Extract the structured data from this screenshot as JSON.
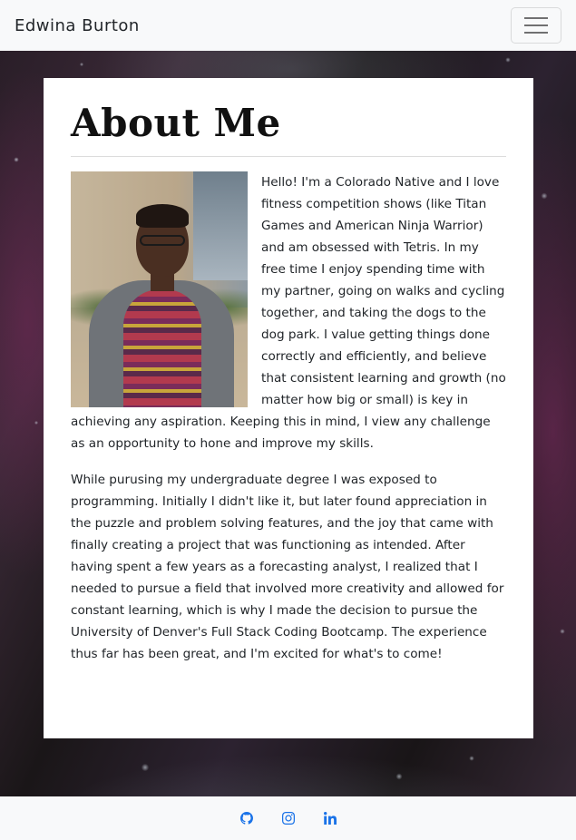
{
  "navbar": {
    "brand": "Edwina Burton",
    "toggler_icon": "hamburger-menu-icon"
  },
  "about": {
    "title": "About Me",
    "photo_icon": "profile-photo",
    "paragraphs": [
      "Hello! I'm a Colorado Native and I love fitness competition shows (like Titan Games and American Ninja Warrior) and am obsessed with Tetris. In my free time I enjoy spending time with my partner, going on walks and cycling together, and taking the dogs to the dog park. I value getting things done correctly and efficiently, and believe that consistent learning and growth (no matter how big or small) is key in achieving any aspiration. Keeping this in mind, I view any challenge as an opportunity to hone and improve my skills.",
      "While purusing my undergraduate degree I was exposed to programming. Initially I didn't like it, but later found appreciation in the puzzle and problem solving features, and the joy that came with finally creating a project that was functioning as intended. After having spent a few years as a forecasting analyst, I realized that I needed to pursue a field that involved more creativity and allowed for constant learning, which is why I made the decision to pursue the University of Denver's Full Stack Coding Bootcamp. The experience thus far has been great, and I'm excited for what's to come!"
    ]
  },
  "footer": {
    "links": [
      {
        "icon": "github-icon"
      },
      {
        "icon": "instagram-icon"
      },
      {
        "icon": "linkedin-icon"
      }
    ],
    "link_color": "#1a73e8"
  }
}
